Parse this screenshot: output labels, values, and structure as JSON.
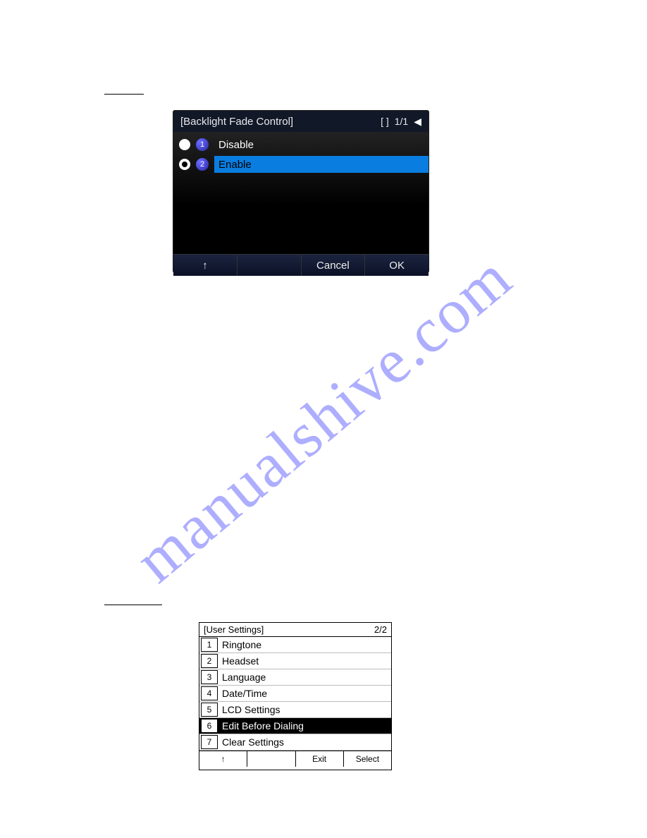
{
  "watermark": "manualshive.com",
  "screen1": {
    "title": "[Backlight Fade Control]",
    "bracket": "[  ]",
    "page": "1/1",
    "options": [
      {
        "num": "1",
        "label": "Disable",
        "selected": false
      },
      {
        "num": "2",
        "label": "Enable",
        "selected": true
      }
    ],
    "softkeys": {
      "up": "↑",
      "cancel": "Cancel",
      "ok": "OK"
    }
  },
  "screen2": {
    "title": "[User Settings]",
    "page": "2/2",
    "items": [
      {
        "num": "1",
        "label": "Ringtone",
        "selected": false
      },
      {
        "num": "2",
        "label": "Headset",
        "selected": false
      },
      {
        "num": "3",
        "label": "Language",
        "selected": false
      },
      {
        "num": "4",
        "label": "Date/Time",
        "selected": false
      },
      {
        "num": "5",
        "label": "LCD Settings",
        "selected": false
      },
      {
        "num": "6",
        "label": "Edit Before Dialing",
        "selected": true
      },
      {
        "num": "7",
        "label": "Clear Settings",
        "selected": false
      }
    ],
    "softkeys": {
      "up": "↑",
      "exit": "Exit",
      "select": "Select"
    }
  }
}
